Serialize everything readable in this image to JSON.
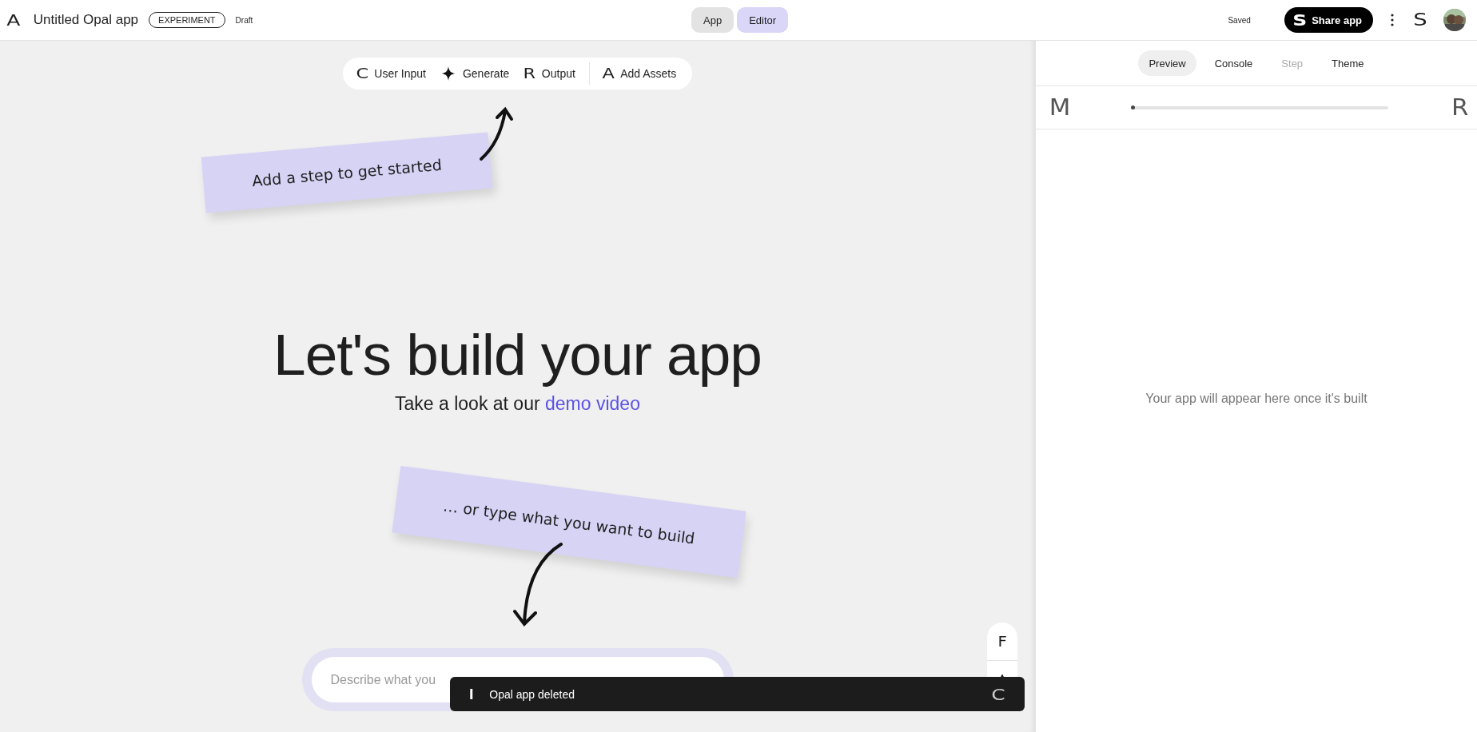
{
  "header": {
    "logo_glyph": "A",
    "title": "Untitled Opal app",
    "badge": "EXPERIMENT",
    "status": "Draft",
    "mode_tabs": [
      {
        "label": "App",
        "selected": false
      },
      {
        "label": "Editor",
        "selected": true
      }
    ],
    "save_status": "Saved",
    "share_button": {
      "glyph": "S",
      "label": "Share app"
    },
    "user_glyph": "S"
  },
  "toolbar": {
    "steps": [
      {
        "kind": "glyph",
        "glyph": "C",
        "label": "User Input"
      },
      {
        "kind": "sparkle",
        "label": "Generate"
      },
      {
        "kind": "glyph",
        "glyph": "R",
        "label": "Output"
      }
    ],
    "assets": {
      "glyph": "A",
      "label": "Add Assets"
    }
  },
  "notes": [
    {
      "text": "Add a step to get started"
    },
    {
      "text": "… or type what you want to build"
    }
  ],
  "hero": {
    "title": "Let's build your app",
    "subtitle": "Take a look at our",
    "link": "demo video"
  },
  "prompt": {
    "placeholder": "Describe what you"
  },
  "side_tools": [
    {
      "glyph": "F"
    }
  ],
  "toast": {
    "glyph": "I",
    "text": "Opal app deleted",
    "action_glyph": "C"
  },
  "preview": {
    "tabs": [
      {
        "label": "Preview",
        "selected": true,
        "disabled": false
      },
      {
        "label": "Console",
        "selected": false,
        "disabled": false
      },
      {
        "label": "Step",
        "selected": false,
        "disabled": true
      },
      {
        "label": "Theme",
        "selected": false,
        "disabled": false
      }
    ],
    "progress": {
      "left_glyph": "M",
      "level": 0,
      "right_glyph": "R"
    },
    "empty_text": "Your app will appear here once it's built"
  }
}
